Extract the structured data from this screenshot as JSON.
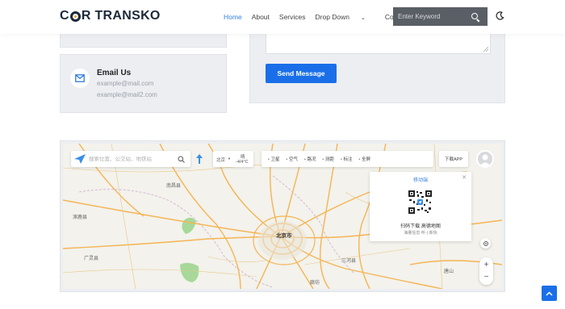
{
  "header": {
    "logo_pre": "C",
    "logo_post": "R TRANSKO",
    "nav": [
      {
        "label": "Home",
        "active": true
      },
      {
        "label": "About"
      },
      {
        "label": "Services"
      },
      {
        "label": "Drop Down"
      },
      {
        "label": "Contact"
      }
    ],
    "search_placeholder": "Enter Keyword"
  },
  "contact": {
    "email_title": "Email Us",
    "emails": [
      "example@mail.com",
      "example@mail2.com"
    ],
    "send_button": "Send Message"
  },
  "map": {
    "search_placeholder": "搜索位置、公交站、地铁站",
    "weather_city": "北京",
    "weather_cond": "晴",
    "weather_temp": "-4/4°C",
    "toolbar": [
      "卫星",
      "空气",
      "路况",
      "测距",
      "标注",
      "全屏"
    ],
    "download_app": "下载APP",
    "qr_title": "移动端",
    "qr_line1": "扫码下载 高德地图",
    "qr_line2": "海量信息·听·|·新快",
    "labels": {
      "beijing": "北京市",
      "langfang": "廊坊",
      "tangshan": "唐山",
      "l1": "南昌县",
      "l2": "广灵县",
      "l3": "三河县",
      "l4": "涿鹿县"
    }
  },
  "colors": {
    "accent": "#1a6fe8",
    "nav_active": "#2f7fe0",
    "header_search_bg": "#5a5f66",
    "panel_bg": "#eceef2"
  }
}
